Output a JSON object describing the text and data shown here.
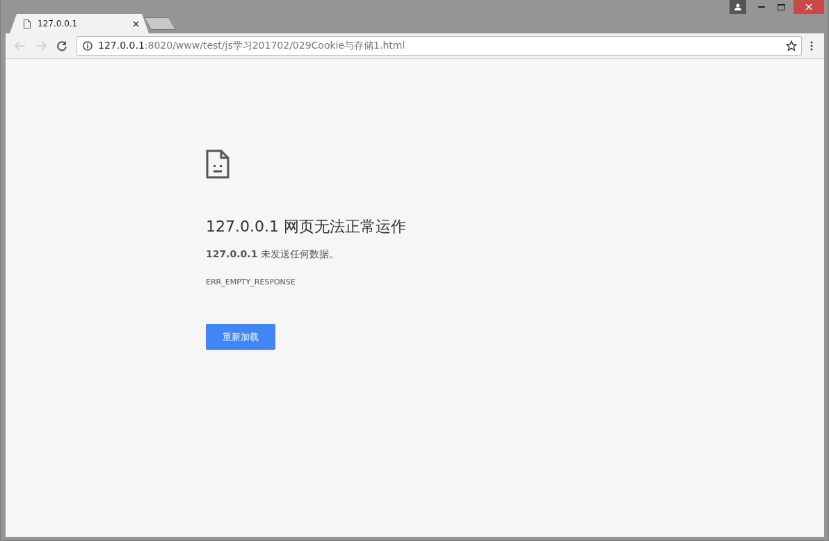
{
  "tabs": [
    {
      "title": "127.0.0.1",
      "selected": true
    }
  ],
  "nav_buttons": [
    {
      "kind": "back",
      "disabled": true
    },
    {
      "kind": "forward",
      "disabled": true
    },
    {
      "kind": "reload",
      "disabled": false
    }
  ],
  "address_bar": {
    "host": "127.0.0.1",
    "path": ":8020/www/test/js学习201702/029Cookie与存储1.html"
  },
  "error": {
    "heading": "127.0.0.1 网页无法正常运作",
    "detail": "**127.0.0.1** 未发送任何数据。",
    "code": "ERR_EMPTY_RESPONSE",
    "button": "重新加载"
  }
}
